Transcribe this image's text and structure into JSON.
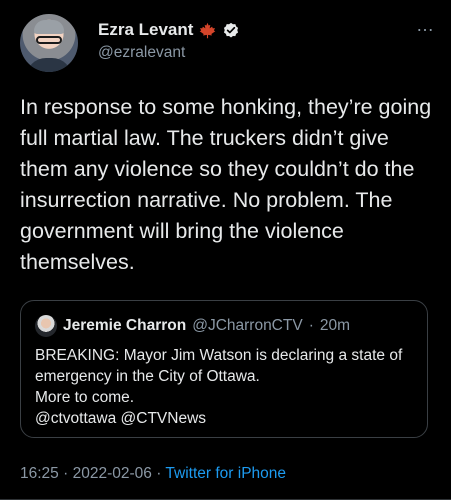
{
  "tweet": {
    "author": {
      "display_name": "Ezra Levant",
      "handle": "@ezralevant",
      "badge_icons": [
        "maple-leaf-icon",
        "verified-icon"
      ]
    },
    "text": "In response to some honking, they’re going full martial law. The truckers didn’t give them any violence so they couldn’t do the insurrection narrative. No problem. The government will bring the violence themselves.",
    "quoted_tweet": {
      "display_name": "Jeremie Charron",
      "handle": "@JCharronCTV",
      "separator": "·",
      "time": "20m",
      "text": "BREAKING: Mayor Jim Watson is declaring a state of emergency in the City of Ottawa.\nMore to come.\n@ctvottawa @CTVNews"
    },
    "time": "16:25",
    "date": "2022-02-06",
    "dot": "·",
    "source": "Twitter for iPhone",
    "more_icon": "…"
  },
  "colors": {
    "background": "#000000",
    "text": "#e7e9ea",
    "secondary_text": "#8b98a5",
    "link": "#1d9bf0",
    "border": "#3a3f44",
    "maple_leaf": "#d4452a",
    "verified": "#e7e9ea"
  }
}
